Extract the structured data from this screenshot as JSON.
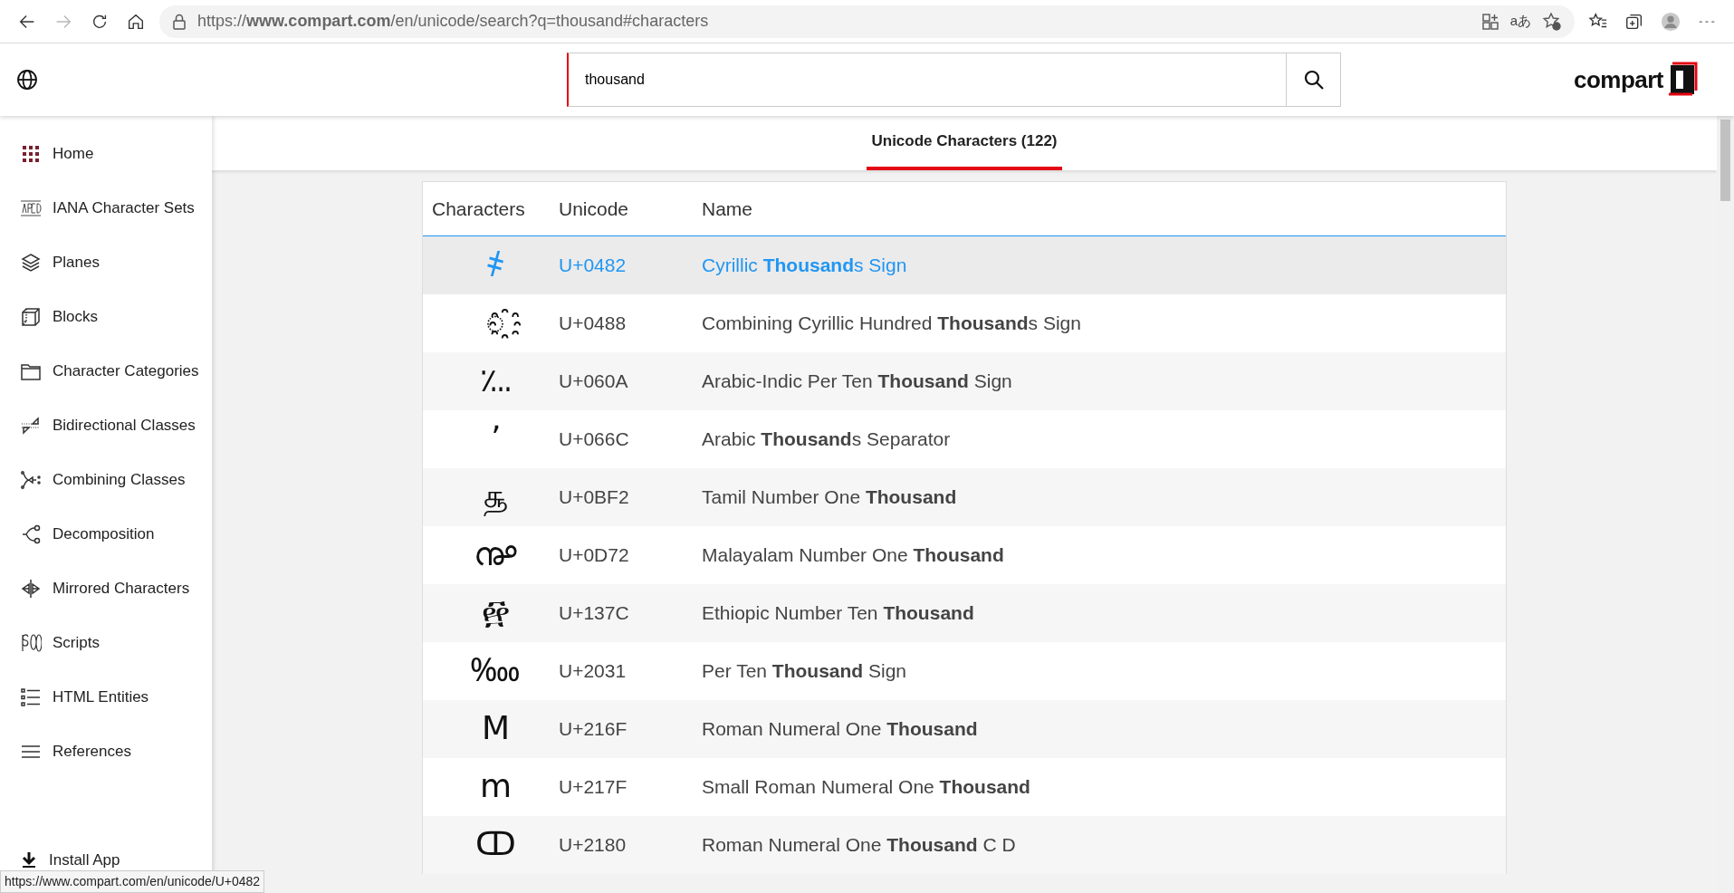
{
  "browser": {
    "url": "https://**www.compart.com**/en/unicode/search?q=thousand#characters",
    "forward_disabled": true,
    "translate_label": "aあ"
  },
  "header": {
    "search_value": "thousand",
    "logo": "compart"
  },
  "sidebar": {
    "items": [
      {
        "label": "Home"
      },
      {
        "label": "IANA Character Sets"
      },
      {
        "label": "Planes"
      },
      {
        "label": "Blocks"
      },
      {
        "label": "Character Categories"
      },
      {
        "label": "Bidirectional Classes"
      },
      {
        "label": "Combining Classes"
      },
      {
        "label": "Decomposition"
      },
      {
        "label": "Mirrored Characters"
      },
      {
        "label": "Scripts"
      },
      {
        "label": "HTML Entities"
      },
      {
        "label": "References"
      }
    ],
    "install": "Install App"
  },
  "tabs": [
    {
      "label": "Unicode Characters (122)",
      "selected": true
    }
  ],
  "table": {
    "columns": [
      "Characters",
      "Unicode",
      "Name"
    ],
    "rows": [
      {
        "character": "҂",
        "code": "U+0482",
        "name": "Cyrillic **Thousand**s Sign",
        "selected": true
      },
      {
        "character": "◌҈",
        "code": "U+0488",
        "name": "Combining Cyrillic Hundred **Thousand**s Sign",
        "selected": false
      },
      {
        "character": "؊",
        "code": "U+060A",
        "name": "Arabic-Indic Per Ten **Thousand** Sign",
        "selected": false
      },
      {
        "character": "٬",
        "code": "U+066C",
        "name": "Arabic **Thousand**s Separator",
        "selected": false
      },
      {
        "character": "௲",
        "code": "U+0BF2",
        "name": "Tamil Number One **Thousand**",
        "selected": false
      },
      {
        "character": "൲",
        "code": "U+0D72",
        "name": "Malayalam Number One **Thousand**",
        "selected": false
      },
      {
        "character": "፼",
        "code": "U+137C",
        "name": "Ethiopic Number Ten **Thousand**",
        "selected": false
      },
      {
        "character": "‱",
        "code": "U+2031",
        "name": "Per Ten **Thousand** Sign",
        "selected": false
      },
      {
        "character": "Ⅿ",
        "code": "U+216F",
        "name": "Roman Numeral One **Thousand**",
        "selected": false
      },
      {
        "character": "ⅿ",
        "code": "U+217F",
        "name": "Small Roman Numeral One **Thousand**",
        "selected": false
      },
      {
        "character": "ↀ",
        "code": "U+2180",
        "name": "Roman Numeral One **Thousand** C D",
        "selected": false
      }
    ]
  },
  "status_bar": {
    "link": "https://www.compart.com/en/unicode/U+0482"
  }
}
